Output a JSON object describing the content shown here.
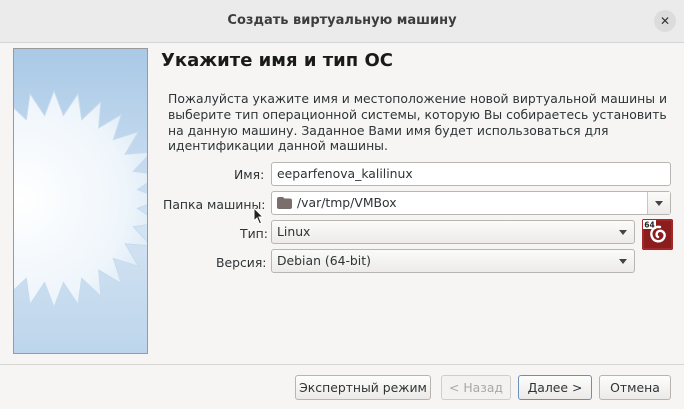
{
  "window": {
    "title": "Создать виртуальную машину",
    "close_glyph": "✕"
  },
  "page": {
    "heading": "Укажите имя и тип ОС",
    "description": "Пожалуйста укажите имя и местоположение новой виртуальной машины и выберите тип операционной системы, которую Вы собираетесь установить на данную машину. Заданное Вами имя будет использоваться для идентификации данной машины."
  },
  "form": {
    "name": {
      "label": "Имя:",
      "value": "eeparfenova_kalilinux"
    },
    "folder": {
      "label": "Папка машины:",
      "value": "/var/tmp/VMBox"
    },
    "type": {
      "label": "Тип:",
      "value": "Linux"
    },
    "version": {
      "label": "Версия:",
      "value": "Debian (64-bit)"
    },
    "os_badge": "64"
  },
  "buttons": {
    "expert": "Экспертный режим",
    "back": "< Назад",
    "next": "Далее >",
    "cancel": "Отмена"
  },
  "colors": {
    "os_icon_bg": "#8b1d1d",
    "default_border": "#6a8fbc"
  }
}
